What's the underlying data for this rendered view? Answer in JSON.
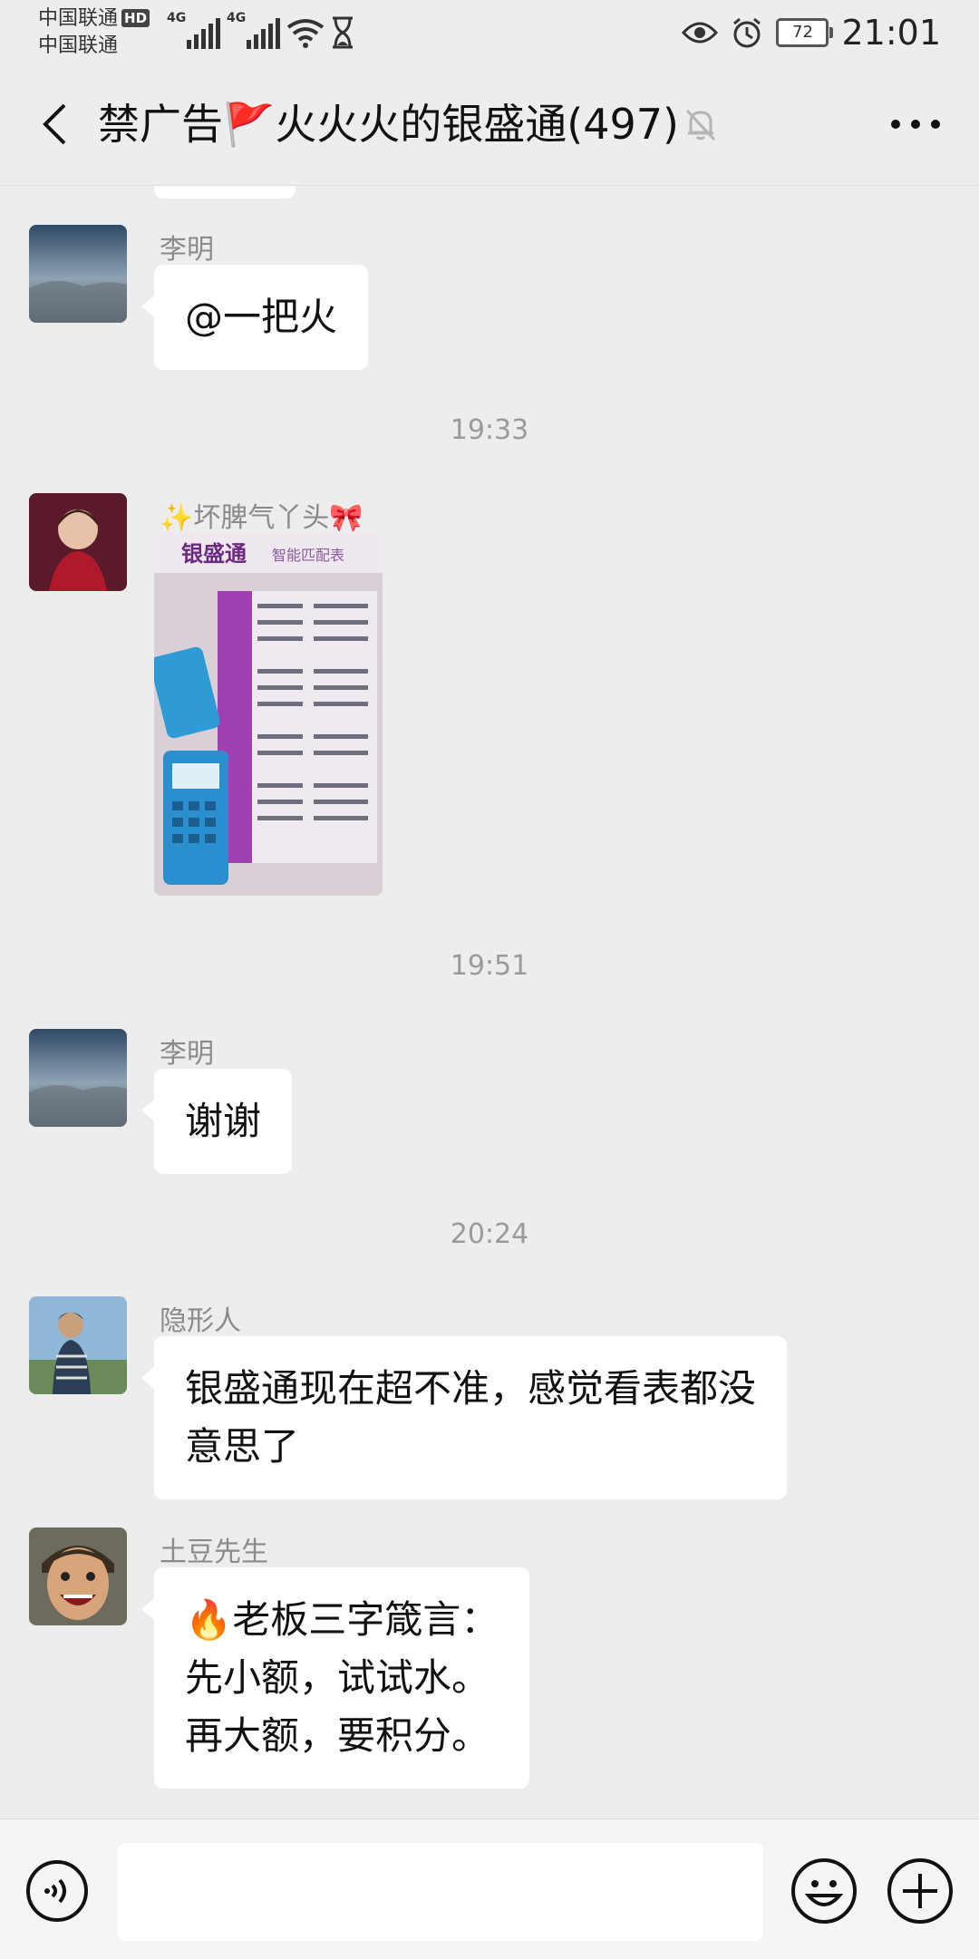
{
  "status": {
    "carrier1": "中国联通",
    "hd": "HD",
    "carrier2": "中国联通",
    "net1": "4G",
    "net2": "4G",
    "battery": "72",
    "time": "21:01"
  },
  "header": {
    "title": "禁广告🚩火火火的银盛通(497)"
  },
  "messages": [
    {
      "sender": "李明",
      "text": "@一把火"
    },
    {
      "time": "19:33"
    },
    {
      "sender": "✨坏脾气丫头🎀",
      "image_caption_top": "银盛通",
      "image_caption_sub": "智能匹配表"
    },
    {
      "time": "19:51"
    },
    {
      "sender": "李明",
      "text": "谢谢"
    },
    {
      "time": "20:24"
    },
    {
      "sender": "隐形人",
      "text_line1": "银盛通现在超不准，感觉看表都没",
      "text_line2": "意思了"
    },
    {
      "sender": "土豆先生",
      "line1": "🔥老板三字箴言：",
      "line2": "先小额，试试水。",
      "line3": "再大额，要积分。"
    }
  ],
  "input": {
    "value": ""
  },
  "icons": [
    "back-arrow-icon",
    "mute-bell-icon",
    "more-icon",
    "voice-icon",
    "emoji-icon",
    "plus-icon"
  ]
}
